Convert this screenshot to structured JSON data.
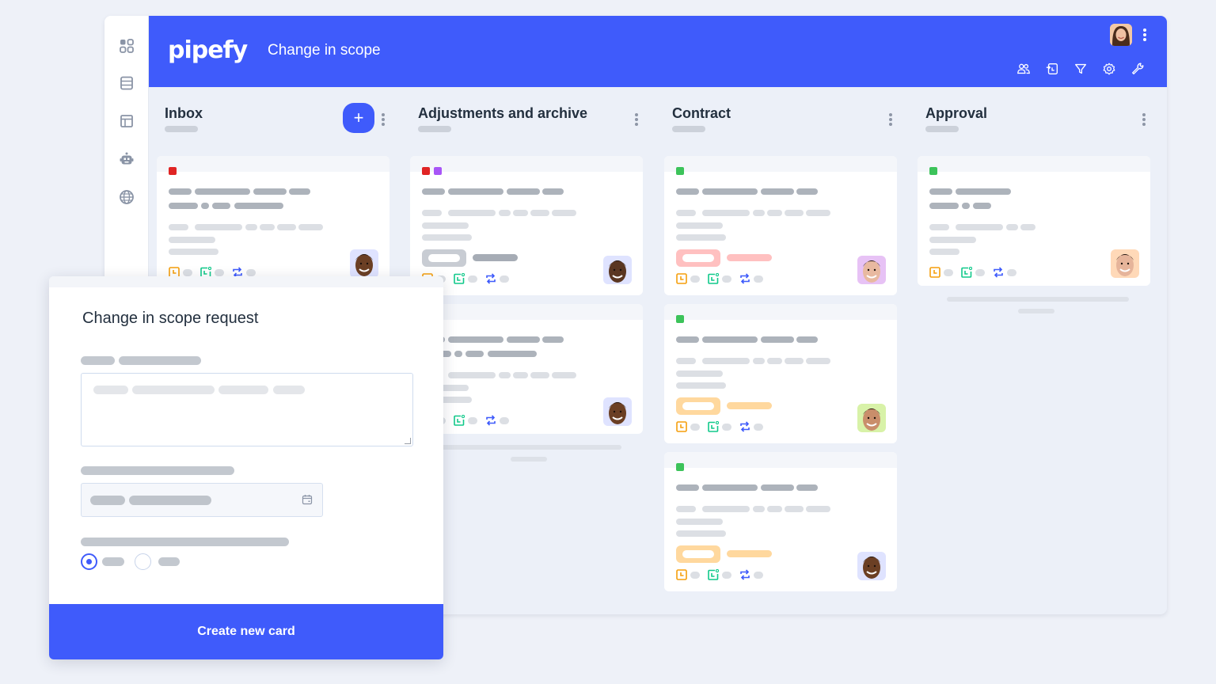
{
  "app": {
    "logo": "pipefy",
    "pipe_title": "Change in scope",
    "sidebar_icons": [
      "apps-grid-icon",
      "database-icon",
      "layout-icon",
      "robot-icon",
      "globe-icon"
    ],
    "toolbar_icons": [
      "members-icon",
      "import-icon",
      "filter-icon",
      "settings-gear-icon",
      "wrench-icon"
    ]
  },
  "colors": {
    "brand": "#3f5bfb",
    "tag_red": "#e02424",
    "tag_purple": "#a855f7",
    "tag_green": "#3cc35a",
    "label_red": "#ffc0c0",
    "label_orange": "#ffd89e",
    "label_gray": "#c8ccd3",
    "icon_orange": "#f59e0b",
    "icon_green": "#10c98a",
    "icon_blue": "#3f5bfb"
  },
  "phases": [
    {
      "title": "Inbox",
      "has_add_button": true,
      "add_label": "+",
      "cards": [
        {
          "tags": [
            "red"
          ],
          "avatar_bg": "#dfe3ff",
          "skin": "#6b3f24",
          "label": null
        }
      ]
    },
    {
      "title": "Adjustments and archive",
      "has_add_button": false,
      "cards": [
        {
          "tags": [
            "red",
            "purple"
          ],
          "avatar_bg": "#dfe3ff",
          "skin": "#5a3621",
          "label": "gray"
        },
        {
          "tags": [],
          "avatar_bg": "#dfe3ff",
          "skin": "#6b3f24",
          "label": null
        }
      ]
    },
    {
      "title": "Contract",
      "has_add_button": false,
      "cards": [
        {
          "tags": [
            "green"
          ],
          "avatar_bg": "#e7c2f5",
          "skin": "#e8b9a0",
          "label": "red"
        },
        {
          "tags": [
            "green"
          ],
          "avatar_bg": "#d8f2a8",
          "skin": "#c98e6b",
          "label": "orange"
        },
        {
          "tags": [
            "green"
          ],
          "avatar_bg": "#dfe3ff",
          "skin": "#6b3f24",
          "label": "orange"
        }
      ]
    },
    {
      "title": "Approval",
      "has_add_button": false,
      "cards": [
        {
          "tags": [
            "green"
          ],
          "avatar_bg": "#ffd9b8",
          "skin": "#e6b49a",
          "label": null
        }
      ]
    }
  ],
  "modal": {
    "title": "Change in scope request",
    "submit_label": "Create new card",
    "radio_selected": 0
  }
}
